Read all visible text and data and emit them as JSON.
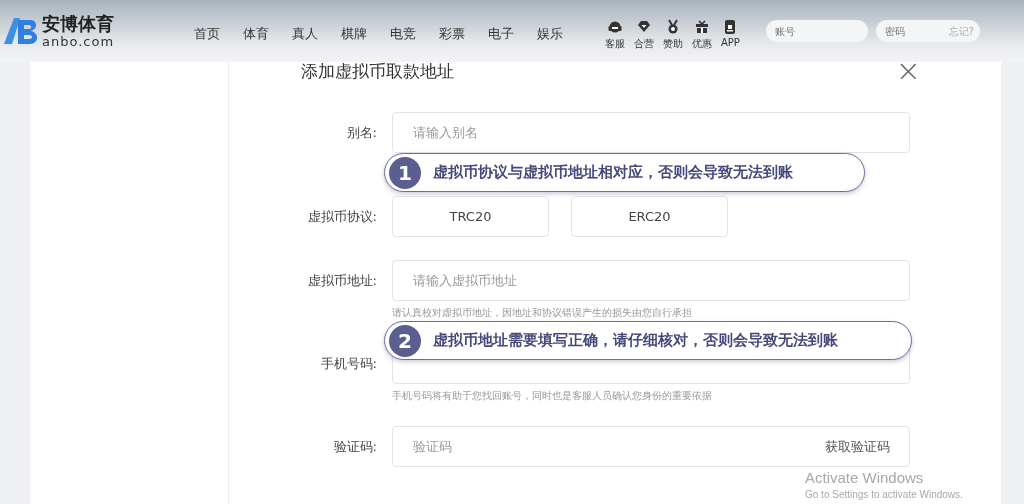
{
  "header": {
    "logo": {
      "name": "安博体育",
      "domain": "anbo.com"
    },
    "nav": [
      {
        "label": "首页"
      },
      {
        "label": "体育"
      },
      {
        "label": "真人"
      },
      {
        "label": "棋牌"
      },
      {
        "label": "电竞"
      },
      {
        "label": "彩票"
      },
      {
        "label": "电子"
      },
      {
        "label": "娱乐"
      }
    ],
    "tools": [
      {
        "label": "客服",
        "kind": "headset"
      },
      {
        "label": "合营",
        "kind": "diamond"
      },
      {
        "label": "赞助",
        "kind": "medal"
      },
      {
        "label": "优惠",
        "kind": "gift"
      },
      {
        "label": "APP",
        "kind": "phone"
      }
    ],
    "login": {
      "account": {
        "placeholder": "账号"
      },
      "password": {
        "placeholder": "密码"
      },
      "forgot": "忘记?"
    }
  },
  "dialog": {
    "title": "添加虚拟币取款地址",
    "close": "×",
    "fields": [
      {
        "kind": "input",
        "label": "别名:",
        "placeholder": "请输入别名"
      },
      {
        "kind": "choice",
        "label": "虚拟币协议:",
        "options": [
          {
            "label": "TRC20",
            "selected": false
          },
          {
            "label": "ERC20",
            "selected": false
          }
        ]
      },
      {
        "kind": "input",
        "label": "虚拟币地址:",
        "placeholder": "请输入虚拟币地址",
        "hint": "请认真校对虚拟币地址，因地址和协议错误产生的损失由您自行承担"
      },
      {
        "kind": "input",
        "label": "手机号码:",
        "hint": "手机号码将有助于您找回账号，同时也是客服人员确认您身份的重要依据"
      },
      {
        "kind": "code",
        "label": "验证码:",
        "placeholder": "验证码",
        "button": "获取验证码"
      }
    ]
  },
  "callouts": [
    {
      "number": "1",
      "text": "虚拟币协议与虚拟币地址相对应，否则会导致无法到账"
    },
    {
      "number": "2",
      "text": "虚拟币地址需要填写正确，请仔细核对，否则会导致无法到账"
    }
  ],
  "os_notice": {
    "title": "Activate Windows",
    "text": "Go to Settings to activate Windows."
  }
}
